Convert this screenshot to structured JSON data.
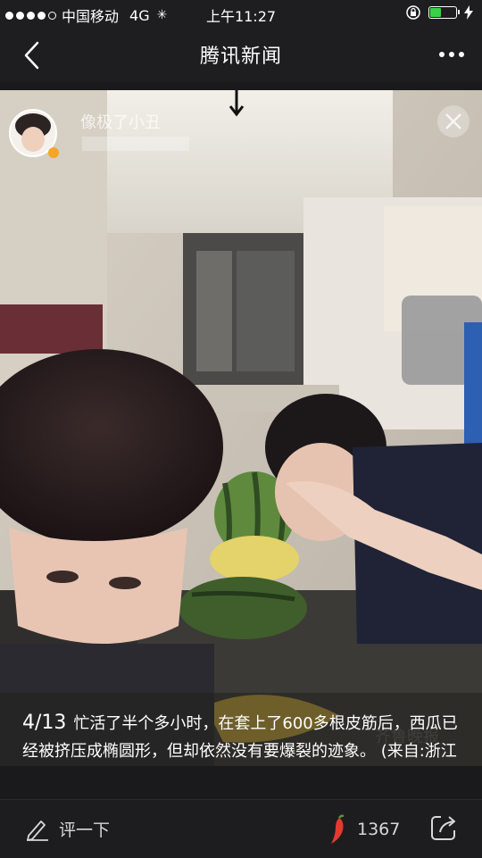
{
  "status_bar": {
    "carrier": "中国移动",
    "network": "4G",
    "time": "上午11:27",
    "signal_bars": 4,
    "battery_level": 0.45,
    "battery_color": "#3ad14a"
  },
  "nav": {
    "title": "腾讯新闻"
  },
  "photo": {
    "overlay_user_name": "像极了小丑",
    "caption_index": "4/13",
    "caption_text": "忙活了半个多小时，在套上了600多根皮筋后，西瓜已经被挤压成椭圆形，但却依然没有要爆裂的迹象。 (来自:浙江在线)"
  },
  "toolbar": {
    "comment_label": "评一下",
    "like_count": "1367"
  },
  "icons": {
    "back": "chevron-left-icon",
    "more": "more-dots-icon",
    "comment": "pencil-icon",
    "like": "chili-pepper-icon",
    "share": "share-icon"
  }
}
